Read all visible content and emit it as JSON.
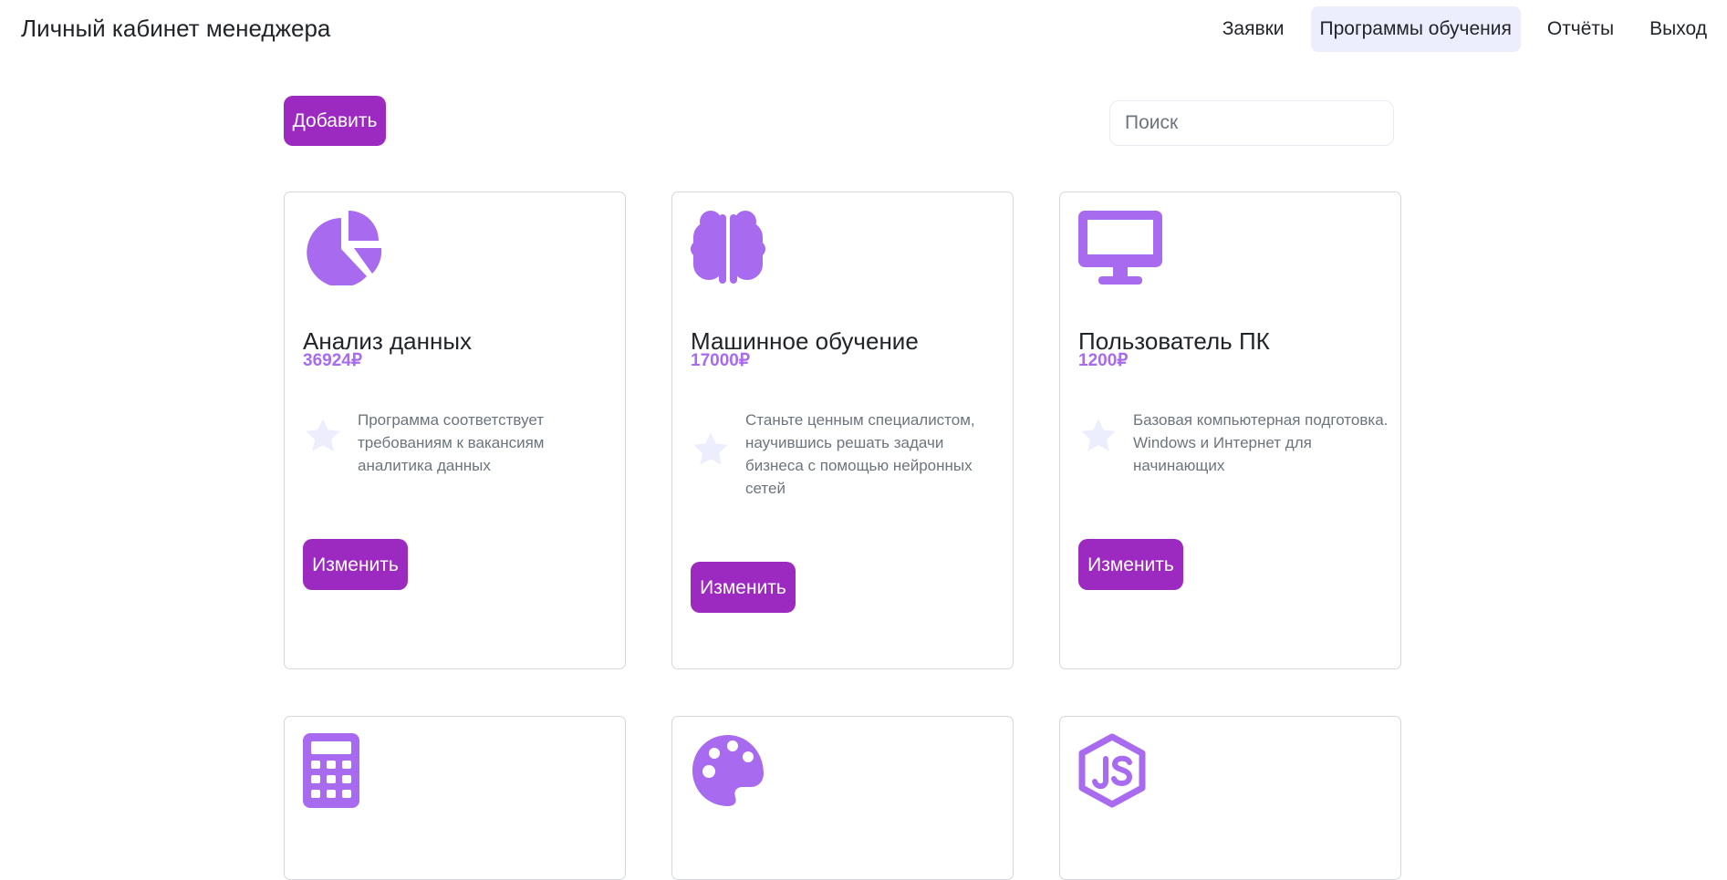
{
  "header": {
    "brand": "Личный кабинет менеджера",
    "nav": [
      {
        "label": "Заявки",
        "active": false
      },
      {
        "label": "Программы обучения",
        "active": true
      },
      {
        "label": "Отчёты",
        "active": false
      },
      {
        "label": "Выход",
        "active": false
      }
    ]
  },
  "toolbar": {
    "add_label": "Добавить",
    "search_placeholder": "Поиск",
    "search_value": ""
  },
  "colors": {
    "accent": "#9c2ac0",
    "icon": "#a86bf0",
    "star": "#eceefd",
    "nav_active_bg": "#eceefd"
  },
  "programs": [
    {
      "icon": "pie-chart-icon",
      "title": "Анализ данных",
      "price": "36924₽",
      "description": "Программа соответствует требованиям к вакансиям аналитика данных",
      "edit_label": "Изменить"
    },
    {
      "icon": "brain-icon",
      "title": "Машинное обучение",
      "price": "17000₽",
      "description": "Станьте ценным специалистом, научившись решать задачи бизнеса с помощью нейронных сетей",
      "edit_label": "Изменить"
    },
    {
      "icon": "desktop-icon",
      "title": "Пользователь ПК",
      "price": "1200₽",
      "description": "Базовая компьютерная подготовка. Windows и Интернет для начинающих",
      "edit_label": "Изменить"
    },
    {
      "icon": "calculator-icon"
    },
    {
      "icon": "palette-icon"
    },
    {
      "icon": "nodejs-icon"
    }
  ]
}
